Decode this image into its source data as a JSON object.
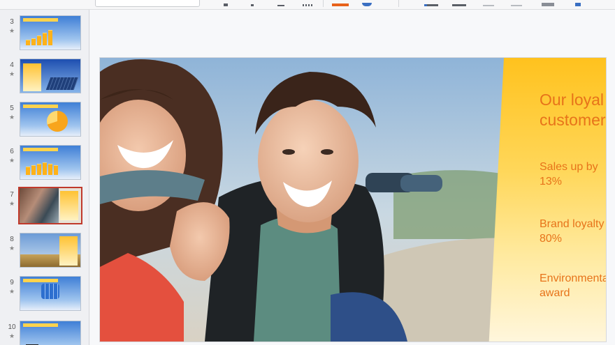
{
  "thumbnails": [
    {
      "number": "3",
      "star": "★",
      "style": "bars"
    },
    {
      "number": "4",
      "star": "★",
      "style": "solar"
    },
    {
      "number": "5",
      "star": "★",
      "style": "pie"
    },
    {
      "number": "6",
      "star": "★",
      "style": "bars2"
    },
    {
      "number": "7",
      "star": "★",
      "style": "photo",
      "selected": true
    },
    {
      "number": "8",
      "star": "★",
      "style": "field"
    },
    {
      "number": "9",
      "star": "★",
      "style": "grid"
    },
    {
      "number": "10",
      "star": "★",
      "style": "dark"
    }
  ],
  "slide": {
    "heading_line1": "Our loyal",
    "heading_line2": "customers",
    "stats": [
      {
        "line1": "Sales up by",
        "line2": "13%",
        "icon": "dollar-house-icon"
      },
      {
        "line1": "Brand loyalty",
        "line2": "80%",
        "icon": "heart-icon"
      },
      {
        "line1": "Environmental",
        "line2": "award",
        "icon": "globe-award-icon"
      }
    ]
  },
  "colors": {
    "accent_orange": "#e7731a",
    "panel_yellow": "#ffc21e",
    "selection_red": "#c0392b"
  }
}
